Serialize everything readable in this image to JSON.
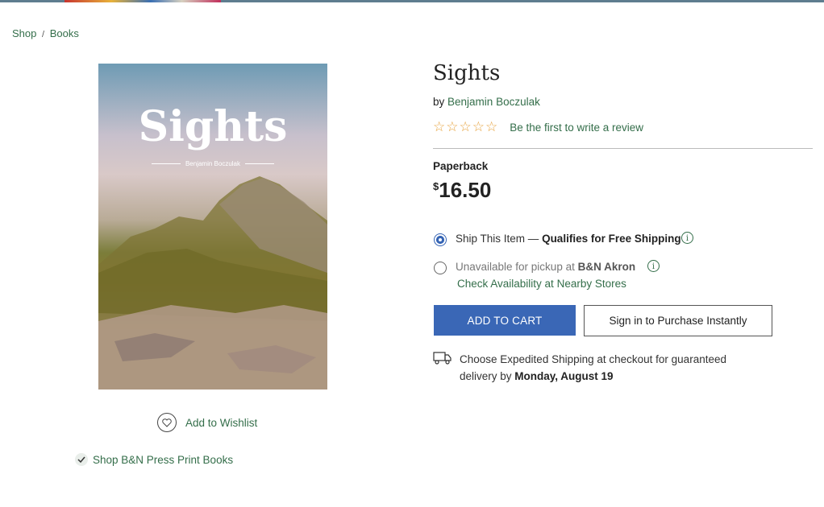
{
  "breadcrumb": {
    "shop": "Shop",
    "separator": "/",
    "books": "Books"
  },
  "cover": {
    "title": "Sights",
    "author": "Benjamin Boczulak"
  },
  "wishlist": {
    "label": "Add to Wishlist",
    "icon": "heart-icon"
  },
  "press_link": {
    "label": "Shop B&N Press Print Books",
    "icon": "check-icon"
  },
  "product": {
    "title": "Sights",
    "by": "by",
    "author": "Benjamin Boczulak",
    "rating_stars": 0,
    "rating_max": 5,
    "review_link": "Be the first to write a review",
    "format": "Paperback",
    "currency": "$",
    "price": "16.50"
  },
  "fulfillment": {
    "ship": {
      "prefix": "Ship This Item —",
      "strong": "Qualifies for Free Shipping",
      "selected": true
    },
    "pickup": {
      "prefix": "Unavailable for pickup at",
      "store": "B&N Akron",
      "selected": false
    },
    "availability_link": "Check Availability at Nearby Stores"
  },
  "buttons": {
    "add_to_cart": "ADD TO CART",
    "sign_in": "Sign in to Purchase Instantly"
  },
  "shipping_note": {
    "text": "Choose Expedited Shipping at checkout for guaranteed delivery by",
    "date": "Monday, August 19"
  },
  "colors": {
    "link_green": "#346e4a",
    "cart_blue": "#3a67b6",
    "star_orange": "#e6a23c"
  }
}
